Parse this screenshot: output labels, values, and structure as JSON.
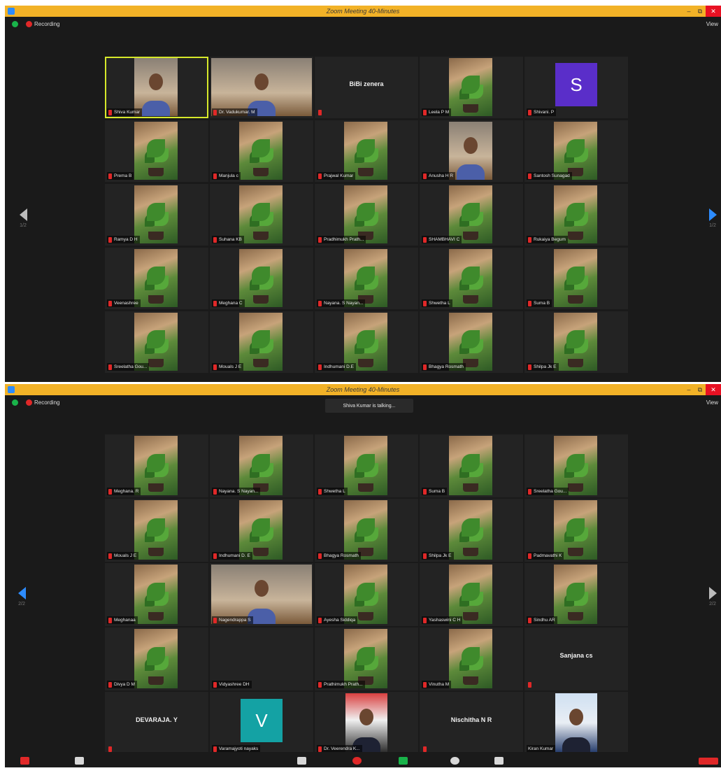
{
  "window": {
    "title": "Zoom Meeting 40-Minutes",
    "recording_label": "Recording",
    "view_label": "View",
    "talking_notice": "Shiva Kumar is talking...",
    "minimize_glyph": "–",
    "maximize_glyph": "⧉",
    "close_glyph": "✕"
  },
  "colors": {
    "titlebar": "#f2b227",
    "active_speaker": "#d6e82a",
    "mic_muted": "#e02828",
    "nav_active": "#2d8cff"
  },
  "screenshot1": {
    "page_left": "1/2",
    "page_right": "1/2",
    "tiles": [
      {
        "name": "Shiva Kumar",
        "kind": "video-person",
        "active": true
      },
      {
        "name": "Dr. Vadukumar. M",
        "kind": "video-person-wide"
      },
      {
        "name": "BiBi zenera",
        "kind": "name-only"
      },
      {
        "name": "Leela P M",
        "kind": "plant"
      },
      {
        "name": "Shivani. P",
        "kind": "avatar",
        "initial": "S",
        "color": "purple"
      },
      {
        "name": "Prema B",
        "kind": "plant"
      },
      {
        "name": "Manjula c",
        "kind": "plant"
      },
      {
        "name": "Prajwal Kumar",
        "kind": "plant"
      },
      {
        "name": "Anusha H R",
        "kind": "video-person"
      },
      {
        "name": "Santosh Sunagad",
        "kind": "plant"
      },
      {
        "name": "Ramya D H",
        "kind": "plant"
      },
      {
        "name": "Suhana KB",
        "kind": "plant"
      },
      {
        "name": "Pradhimukh Prath...",
        "kind": "plant"
      },
      {
        "name": "SHAMBHAVI C",
        "kind": "plant"
      },
      {
        "name": "Rukaiya Begum",
        "kind": "plant"
      },
      {
        "name": "Veenashree",
        "kind": "plant"
      },
      {
        "name": "Meghana C",
        "kind": "plant"
      },
      {
        "name": "Nayana. S Nayan...",
        "kind": "plant"
      },
      {
        "name": "Shwetha L",
        "kind": "plant"
      },
      {
        "name": "Suma B",
        "kind": "plant"
      },
      {
        "name": "Sreelatha Gou...",
        "kind": "plant"
      },
      {
        "name": "Mouals J E",
        "kind": "plant"
      },
      {
        "name": "Indhumani D.E",
        "kind": "plant"
      },
      {
        "name": "Bhagya Rosmath",
        "kind": "plant"
      },
      {
        "name": "Shilpa Jk E",
        "kind": "plant"
      }
    ]
  },
  "screenshot2": {
    "page_left": "2/2",
    "page_right": "2/2",
    "tiles": [
      {
        "name": "Meghana. R",
        "kind": "plant"
      },
      {
        "name": "Nayana. S Nayan...",
        "kind": "plant"
      },
      {
        "name": "Shwetha L",
        "kind": "plant"
      },
      {
        "name": "Suma B",
        "kind": "plant"
      },
      {
        "name": "Sreelatha Gou...",
        "kind": "plant"
      },
      {
        "name": "Mouals J E",
        "kind": "plant"
      },
      {
        "name": "Indhumani D. E",
        "kind": "plant"
      },
      {
        "name": "Bhagya Rosmath",
        "kind": "plant"
      },
      {
        "name": "Shilpa Jk E",
        "kind": "plant"
      },
      {
        "name": "Padmavathi K",
        "kind": "plant"
      },
      {
        "name": "Meghanaa",
        "kind": "plant"
      },
      {
        "name": "Nagendrappa S",
        "kind": "video-person-wide"
      },
      {
        "name": "Ayesha Siddiqa",
        "kind": "plant"
      },
      {
        "name": "Yashaswini C H",
        "kind": "plant"
      },
      {
        "name": "Sindhu AR",
        "kind": "plant"
      },
      {
        "name": "Divya D M",
        "kind": "plant"
      },
      {
        "name": "Vidyashree DH",
        "kind": "empty"
      },
      {
        "name": "Prathimukh Prath...",
        "kind": "plant"
      },
      {
        "name": "Vinutha M",
        "kind": "plant"
      },
      {
        "name": "Sanjana cs",
        "kind": "name-only"
      },
      {
        "name": "DEVARAJA. Y",
        "kind": "name-only"
      },
      {
        "name": "Varamajyoti nayaks",
        "kind": "avatar",
        "initial": "V",
        "color": "teal"
      },
      {
        "name": "Dr. Veerendra K...",
        "kind": "portrait"
      },
      {
        "name": "Nischitha N R",
        "kind": "name-only"
      },
      {
        "name": "Kiran Kumar",
        "kind": "portrait-light",
        "no_mic": true
      }
    ]
  }
}
